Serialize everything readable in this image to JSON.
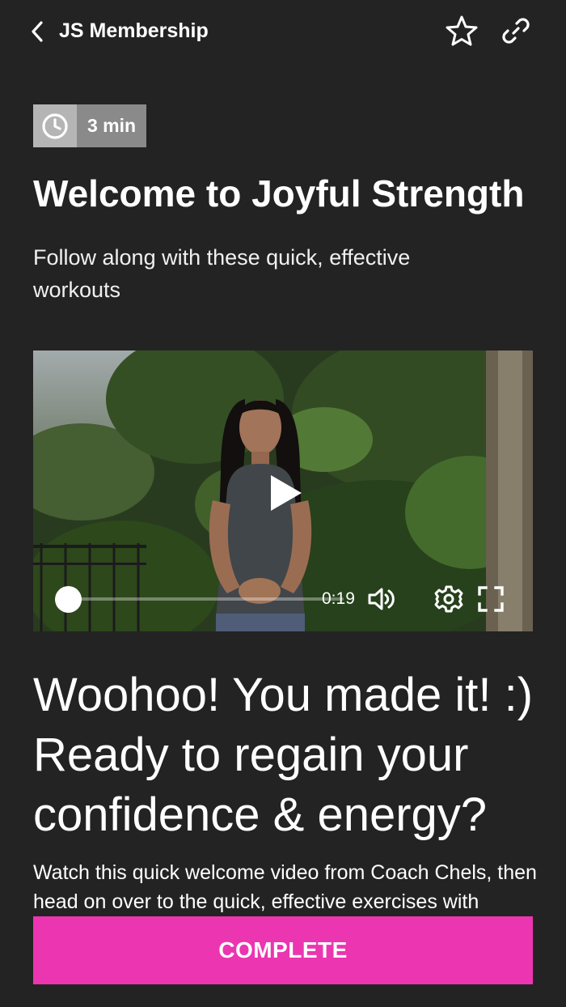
{
  "header": {
    "title": "JS Membership",
    "back_icon": "chevron-left-icon",
    "favorite_icon": "star-icon",
    "share_icon": "link-icon"
  },
  "lesson": {
    "duration_icon": "clock-icon",
    "duration": "3 min",
    "title": "Welcome to Joyful Strength",
    "subtitle": "Follow along with these quick, effective workouts"
  },
  "video": {
    "current_time": "0:19",
    "progress_fraction": 0.0,
    "icons": [
      "play-icon",
      "volume-icon",
      "gear-icon",
      "fullscreen-icon"
    ]
  },
  "content": {
    "heading": "Woohoo! You made it! :) Ready to regain your confidence & energy?",
    "body": "Watch this quick welcome video from Coach Chels, then head on over to the quick, effective exercises with"
  },
  "actions": {
    "complete_label": "COMPLETE"
  },
  "colors": {
    "background": "#232323",
    "accent": "#ec35b0",
    "duration_badge_icon_bg": "#b5b5b5",
    "duration_badge_text_bg": "#8a8a8a"
  }
}
